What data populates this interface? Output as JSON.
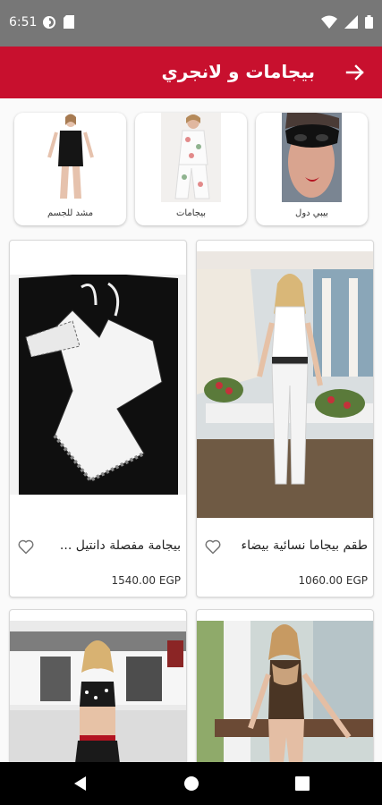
{
  "status_bar": {
    "time": "6:51",
    "left_icons": [
      "circle-status-icon",
      "sd-card-icon"
    ],
    "right_icons": [
      "wifi-icon",
      "signal-icon",
      "battery-icon"
    ]
  },
  "app_bar": {
    "title": "بيجامات و لانجري",
    "back_icon": "arrow-right-icon",
    "color": "#c8102e"
  },
  "categories": [
    {
      "label": "بيبي دول"
    },
    {
      "label": "بيجامات"
    },
    {
      "label": "مشد للجسم"
    }
  ],
  "products": [
    {
      "name": "طقم بيجاما نسائية بيضاء",
      "price": "1060.00 EGP"
    },
    {
      "name": "بيجامة مفصلة دانتيل ...",
      "price": "1540.00 EGP"
    },
    {
      "name": "",
      "price": ""
    },
    {
      "name": "",
      "price": ""
    }
  ],
  "nav_bar": {
    "buttons": [
      "back-triangle-icon",
      "home-circle-icon",
      "recents-square-icon"
    ]
  }
}
